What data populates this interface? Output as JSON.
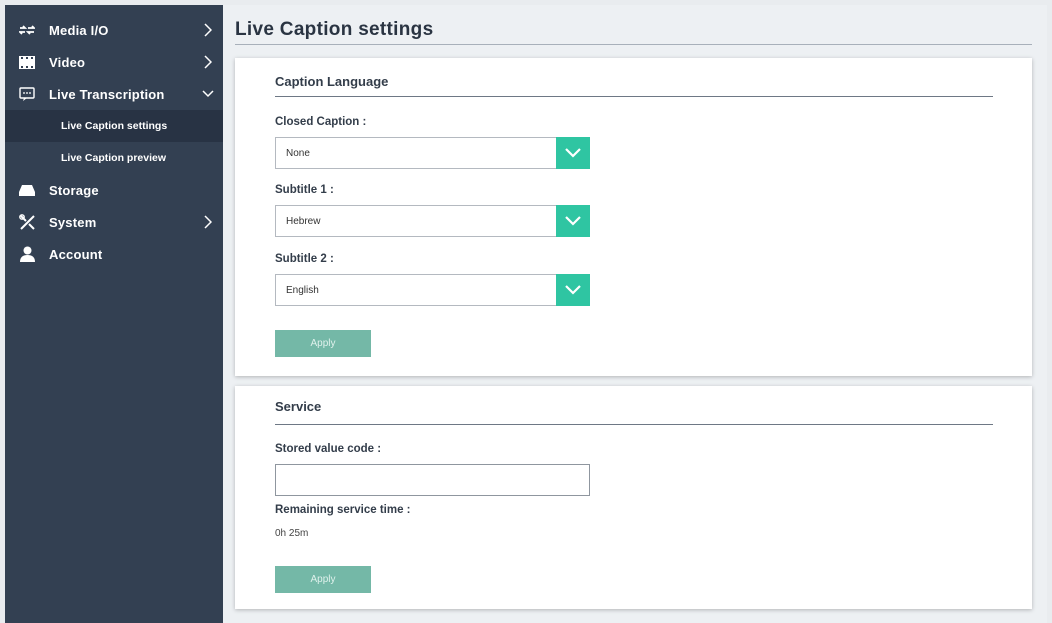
{
  "sidebar": {
    "items": [
      {
        "label": "Media I/O",
        "icon": "media-io-icon"
      },
      {
        "label": "Video",
        "icon": "film-icon"
      },
      {
        "label": "Live Transcription",
        "icon": "caption-icon"
      },
      {
        "label": "Storage",
        "icon": "storage-icon"
      },
      {
        "label": "System",
        "icon": "tools-icon"
      },
      {
        "label": "Account",
        "icon": "user-icon"
      }
    ],
    "subitems": [
      {
        "label": "Live Caption settings",
        "active": true
      },
      {
        "label": "Live Caption preview",
        "active": false
      }
    ]
  },
  "page": {
    "title": "Live Caption settings"
  },
  "caption_language": {
    "title": "Caption Language",
    "closed_caption_label": "Closed Caption :",
    "closed_caption_value": "None",
    "subtitle1_label": "Subtitle 1 :",
    "subtitle1_value": "Hebrew",
    "subtitle2_label": "Subtitle 2 :",
    "subtitle2_value": "English",
    "apply_label": "Apply"
  },
  "service": {
    "title": "Service",
    "stored_value_label": "Stored value code :",
    "stored_value_value": "",
    "remaining_label": "Remaining service time :",
    "remaining_value": "0h 25m",
    "apply_label": "Apply"
  },
  "colors": {
    "sidebar": "#334052",
    "accent": "#2fc5a2",
    "button": "#74b8a7"
  }
}
